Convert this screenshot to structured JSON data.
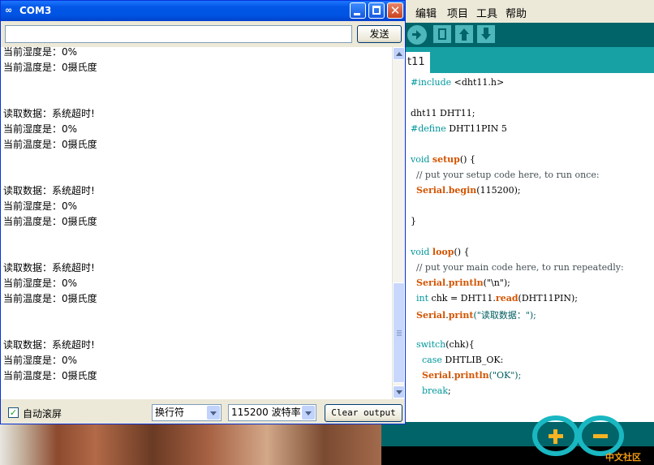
{
  "ide": {
    "menu": [
      "编辑",
      "项目",
      "工具",
      "帮助"
    ],
    "tab_label": "t11",
    "code": [
      {
        "segs": [
          {
            "t": "#include ",
            "c": "k-teal"
          },
          {
            "t": "<dht11.h>",
            "c": ""
          }
        ]
      },
      {
        "segs": []
      },
      {
        "segs": [
          {
            "t": "dht11 DHT11;",
            "c": ""
          }
        ]
      },
      {
        "segs": [
          {
            "t": "#define ",
            "c": "k-teal"
          },
          {
            "t": "DHT11PIN 5",
            "c": ""
          }
        ]
      },
      {
        "segs": []
      },
      {
        "segs": [
          {
            "t": "void ",
            "c": "k-teal"
          },
          {
            "t": "setup",
            "c": "k-orange"
          },
          {
            "t": "() {",
            "c": ""
          }
        ]
      },
      {
        "segs": [
          {
            "t": "  // put your setup code here, to run once:",
            "c": "k-comment"
          }
        ]
      },
      {
        "segs": [
          {
            "t": "  ",
            "c": ""
          },
          {
            "t": "Serial",
            "c": "k-orange"
          },
          {
            "t": ".",
            "c": ""
          },
          {
            "t": "begin",
            "c": "k-orange"
          },
          {
            "t": "(115200);",
            "c": ""
          }
        ]
      },
      {
        "segs": []
      },
      {
        "segs": [
          {
            "t": "}",
            "c": ""
          }
        ]
      },
      {
        "segs": []
      },
      {
        "segs": [
          {
            "t": "void ",
            "c": "k-teal"
          },
          {
            "t": "loop",
            "c": "k-orange"
          },
          {
            "t": "() {",
            "c": ""
          }
        ]
      },
      {
        "segs": [
          {
            "t": "  // put your main code here, to run repeatedly:",
            "c": "k-comment"
          }
        ]
      },
      {
        "segs": [
          {
            "t": "  ",
            "c": ""
          },
          {
            "t": "Serial",
            "c": "k-orange"
          },
          {
            "t": ".",
            "c": ""
          },
          {
            "t": "println",
            "c": "k-orange"
          },
          {
            "t": "(\"\\n\");",
            "c": ""
          }
        ]
      },
      {
        "segs": [
          {
            "t": "  ",
            "c": ""
          },
          {
            "t": "int ",
            "c": "k-teal"
          },
          {
            "t": "chk = DHT11.",
            "c": ""
          },
          {
            "t": "read",
            "c": "k-orange"
          },
          {
            "t": "(DHT11PIN);",
            "c": ""
          }
        ]
      },
      {
        "segs": [
          {
            "t": "  ",
            "c": ""
          },
          {
            "t": "Serial",
            "c": "k-orange"
          },
          {
            "t": ".",
            "c": ""
          },
          {
            "t": "print",
            "c": "k-orange"
          },
          {
            "t": "(\"读取数据：\");",
            "c": "k-str"
          }
        ]
      },
      {
        "segs": []
      },
      {
        "segs": [
          {
            "t": "  ",
            "c": ""
          },
          {
            "t": "switch",
            "c": "k-teal"
          },
          {
            "t": "(chk){",
            "c": ""
          }
        ]
      },
      {
        "segs": [
          {
            "t": "    ",
            "c": ""
          },
          {
            "t": "case ",
            "c": "k-teal"
          },
          {
            "t": "DHTLIB_OK:",
            "c": ""
          }
        ]
      },
      {
        "segs": [
          {
            "t": "    ",
            "c": ""
          },
          {
            "t": "Serial",
            "c": "k-orange"
          },
          {
            "t": ".",
            "c": ""
          },
          {
            "t": "println",
            "c": "k-orange"
          },
          {
            "t": "(\"OK\");",
            "c": "k-str"
          }
        ]
      },
      {
        "segs": [
          {
            "t": "    ",
            "c": ""
          },
          {
            "t": "break",
            "c": "k-teal"
          },
          {
            "t": ";",
            "c": ""
          }
        ]
      }
    ]
  },
  "logo_text": "中文社区",
  "serial": {
    "title": "COM3",
    "send_label": "发送",
    "input_value": "",
    "output_lines": [
      "当前湿度是：0%",
      "当前温度是：0摄氏度",
      "",
      "",
      "读取数据：系统超时!",
      "当前湿度是：0%",
      "当前温度是：0摄氏度",
      "",
      "",
      "读取数据：系统超时!",
      "当前湿度是：0%",
      "当前温度是：0摄氏度",
      "",
      "",
      "读取数据：系统超时!",
      "当前湿度是：0%",
      "当前温度是：0摄氏度",
      "",
      "",
      "读取数据：系统超时!",
      "当前湿度是：0%",
      "当前温度是：0摄氏度"
    ],
    "autoscroll_label": "自动滚屏",
    "autoscroll_checked": true,
    "line_ending": "换行符",
    "baud_rate": "115200 波特率",
    "clear_label": "Clear output",
    "scroll_position": 0.95
  },
  "colors": {
    "title_bar": "#0054e3",
    "ide_teal": "#006468",
    "ide_keyword": "#00979c",
    "ide_function": "#d35400"
  }
}
